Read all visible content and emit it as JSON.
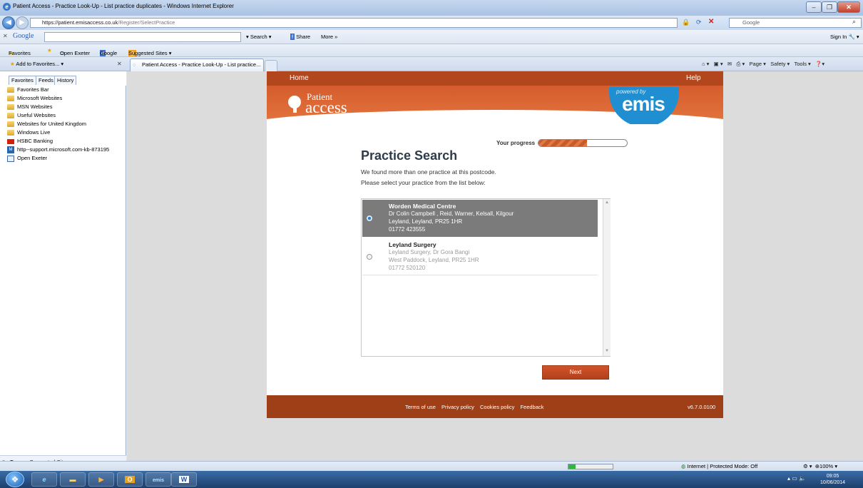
{
  "window": {
    "title": "Patient Access  - Practice Look-Up - List practice duplicates - Windows Internet Explorer"
  },
  "address": {
    "url_host": "https://patient.emisaccess.co.uk",
    "url_path": "/Register/SelectPractice",
    "search_engine": "Google"
  },
  "google_toolbar": {
    "brand": "Google",
    "search": "Search",
    "share": "Share",
    "more": "More »",
    "sign_in": "Sign In"
  },
  "favorites_bar": {
    "favorites": "Favorites",
    "open_exeter": "Open Exeter",
    "google": "Google",
    "suggested": "Suggested Sites ▾"
  },
  "tabs": {
    "active": "Patient Access  - Practice Look-Up - List practice..."
  },
  "command_bar": {
    "page": "Page ▾",
    "safety": "Safety ▾",
    "tools": "Tools ▾"
  },
  "left_pane": {
    "add_to_favorites": "Add to Favorites...  ▾",
    "tabs": [
      "Favorites",
      "Feeds",
      "History"
    ],
    "items": [
      {
        "label": "Favorites Bar",
        "icon": "folder-icon"
      },
      {
        "label": "Microsoft Websites",
        "icon": "folder-icon"
      },
      {
        "label": "MSN Websites",
        "icon": "folder-icon"
      },
      {
        "label": "Useful Websites",
        "icon": "folder-icon"
      },
      {
        "label": "Websites for United Kingdom",
        "icon": "folder-icon"
      },
      {
        "label": "Windows Live",
        "icon": "folder-icon"
      },
      {
        "label": "HSBC Banking",
        "icon": "hsbc-icon"
      },
      {
        "label": "http--support.microsoft.com-kb-873195",
        "icon": "microsoft-icon"
      },
      {
        "label": "Open Exeter",
        "icon": "page-icon"
      }
    ],
    "bottom": "Turn on Suggested Sites..."
  },
  "site": {
    "nav": {
      "home": "Home",
      "help": "Help"
    },
    "logo": {
      "patient": "Patient",
      "access": "access"
    },
    "emis": {
      "powered_by": "powered by",
      "name": "emis"
    },
    "progress": {
      "label": "Your progress",
      "fraction": 0.55
    },
    "heading": "Practice Search",
    "intro1": "We found more than one practice at this postcode.",
    "intro2": "Please select your practice from the list below:",
    "practices": [
      {
        "name": "Worden Medical Centre",
        "doctors": "Dr Colin Campbell , Reid, Warner, Kelsall, Kilgour",
        "address": "Leyland, Leyland, PR25 1HR",
        "phone": "01772 423555",
        "selected": true
      },
      {
        "name": "Leyland Surgery",
        "doctors": "Leyland Surgery, Dr Gora Bangi",
        "address": "West Paddock, Leyland, PR25 1HR",
        "phone": "01772 520120",
        "selected": false
      }
    ],
    "next_label": "Next",
    "footer": {
      "terms": "Terms of use",
      "privacy": "Privacy policy",
      "cookies": "Cookies policy",
      "feedback": "Feedback",
      "version": "v6.7.0.0100"
    }
  },
  "status_bar": {
    "zone": "Internet | Protected Mode: Off",
    "zoom": "100%"
  },
  "taskbar": {
    "time": "09:05",
    "date": "10/06/2014",
    "emis_btn": "emis",
    "word_btn": "W",
    "outlook_btn": "O"
  }
}
